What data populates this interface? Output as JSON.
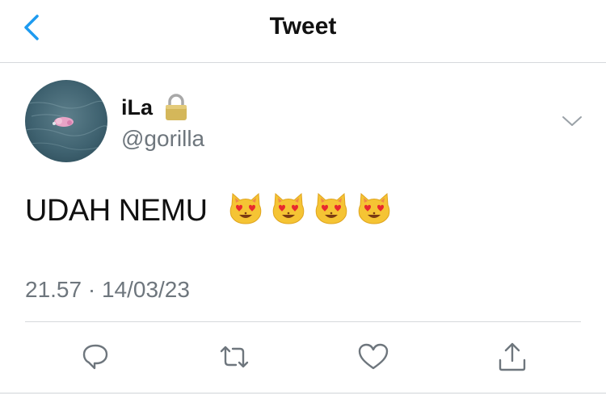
{
  "header": {
    "title": "Tweet",
    "back_icon": "chevron-left-icon",
    "accent_color": "#1d9bf0"
  },
  "tweet": {
    "author": {
      "display_name": "iLa",
      "username": "@gorilla",
      "protected": true,
      "avatar": "avatar-sea-photo"
    },
    "text": "UDAH NEMU",
    "emojis": [
      "heart-eyes-cat-emoji",
      "heart-eyes-cat-emoji",
      "heart-eyes-cat-emoji",
      "heart-eyes-cat-emoji"
    ],
    "timestamp": "21.57 · 14/03/23"
  },
  "actions": [
    {
      "name": "reply",
      "icon": "reply-icon"
    },
    {
      "name": "retweet",
      "icon": "retweet-icon"
    },
    {
      "name": "like",
      "icon": "heart-icon"
    },
    {
      "name": "share",
      "icon": "share-icon"
    }
  ],
  "colors": {
    "text": "#111111",
    "secondary": "#6e767d",
    "icon": "#6e767d",
    "divider": "#d6d9dc"
  }
}
